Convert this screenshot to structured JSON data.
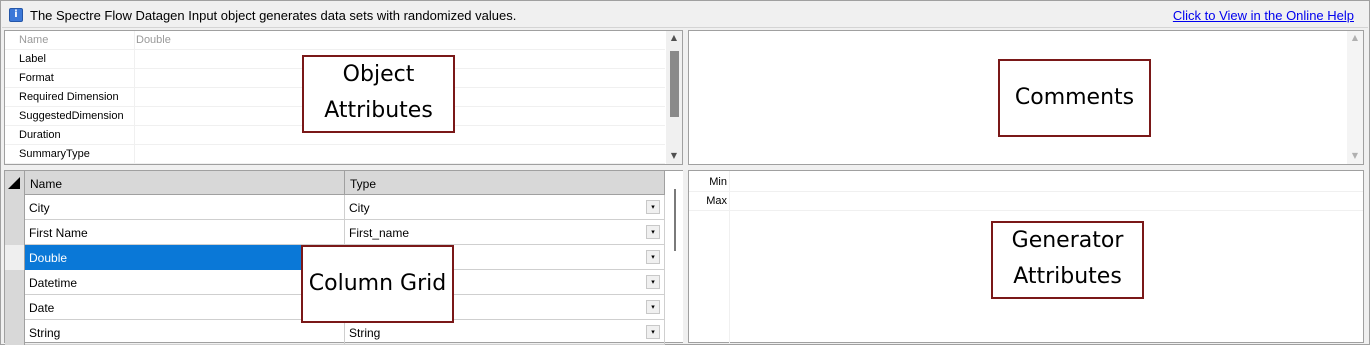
{
  "info_bar": {
    "icon": "info-icon",
    "icon_glyph": "i",
    "message": "The Spectre Flow Datagen Input object generates data sets with randomized values.",
    "help_link": "Click to View in the Online Help"
  },
  "object_attributes": {
    "rows": [
      {
        "name": "Name",
        "value": "Double"
      },
      {
        "name": "Label",
        "value": ""
      },
      {
        "name": "Format",
        "value": ""
      },
      {
        "name": "Required Dimension",
        "value": ""
      },
      {
        "name": "SuggestedDimension",
        "value": ""
      },
      {
        "name": "Duration",
        "value": ""
      },
      {
        "name": "SummaryType",
        "value": ""
      }
    ]
  },
  "column_grid": {
    "headers": [
      "Name",
      "Type"
    ],
    "rows": [
      {
        "name": "City",
        "type": "City"
      },
      {
        "name": "First Name",
        "type": "First_name"
      },
      {
        "name": "Double",
        "type": ""
      },
      {
        "name": "Datetime",
        "type": ""
      },
      {
        "name": "Date",
        "type": ""
      },
      {
        "name": "String",
        "type": "String"
      }
    ],
    "selected_row": "Double",
    "dropdown_glyph": "▾"
  },
  "generator_attributes": {
    "rows": [
      "Min",
      "Max"
    ]
  },
  "scroll_glyphs": {
    "up": "▲",
    "down": "▼"
  },
  "callouts": {
    "object_attributes": [
      "Object",
      "Attributes"
    ],
    "comments": "Comments",
    "column_grid": "Column Grid",
    "generator_attributes": [
      "Generator",
      "Attributes"
    ]
  },
  "colors": {
    "selection": "#0a78d7",
    "callout_border": "#7a1818",
    "link": "#0000ee"
  }
}
